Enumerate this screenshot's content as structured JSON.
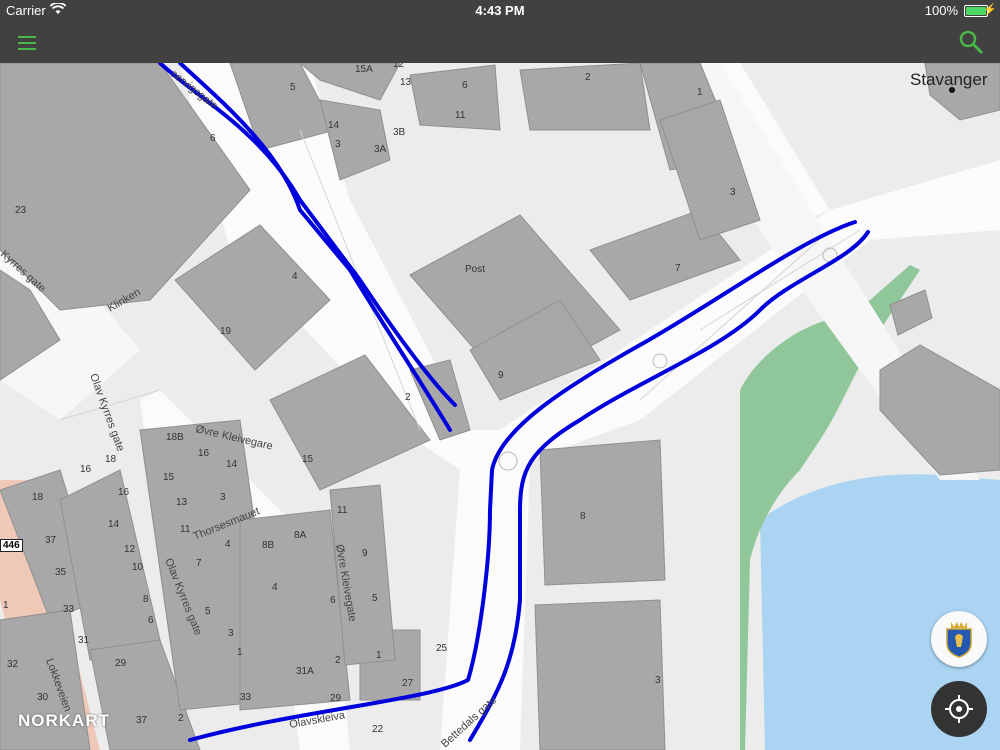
{
  "status_bar": {
    "carrier": "Carrier",
    "time": "4:43 PM",
    "battery": "100%"
  },
  "nav": {
    "menu_icon": "hamburger-menu-icon",
    "search_icon": "search-icon",
    "accent_color": "#49b64a"
  },
  "map": {
    "place_label": "Stavanger",
    "poi_label": "Post",
    "streets": [
      "Klinken",
      "Olav Kyrres gate",
      "Olav Kyrres gate",
      "Olav Kyrres gate",
      "Øvre Kleivegare",
      "Thorsesmauet",
      "Øvre Kleivegate",
      "Lokkeveien",
      "Olavskleiva",
      "Bettedals gate",
      "servigsgate",
      "Kyrres gate"
    ],
    "house_numbers": {
      "h1": "5",
      "h2": "15A",
      "h3": "12",
      "h4": "13",
      "h5": "6",
      "h6": "11",
      "h7": "2",
      "h8": "1",
      "h9": "6",
      "h10": "14",
      "h11": "3B",
      "h12": "3",
      "h13": "3A",
      "h14": "3",
      "h15": "23",
      "h16": "7",
      "h17": "4",
      "h18": "19",
      "h19": "9",
      "h20": "2",
      "h21": "15",
      "h22": "18B",
      "h23": "16",
      "h24": "14",
      "h25": "15",
      "h26": "13",
      "h27": "3",
      "h28": "11",
      "h29": "8A",
      "h30": "8B",
      "h31": "4",
      "h32": "11",
      "h33": "9",
      "h34": "7",
      "h35": "5",
      "h36": "4",
      "h37": "6",
      "h38": "5",
      "h39": "3",
      "h40": "1",
      "h41": "25",
      "h42": "1",
      "h43": "2",
      "h44": "31A",
      "h45": "27",
      "h46": "33",
      "h47": "29",
      "h48": "22",
      "h49": "2",
      "h50": "16",
      "h51": "18",
      "h52": "18",
      "h53": "16",
      "h54": "37",
      "h55": "14",
      "h56": "35",
      "h57": "12",
      "h58": "10",
      "h59": "33",
      "h60": "8",
      "h61": "31",
      "h62": "6",
      "h63": "29",
      "h64": "32",
      "h65": "30",
      "h66": "37",
      "h67": "8",
      "h68": "3",
      "h69": "1"
    },
    "route_number": "446",
    "route_color": "#0000dd",
    "water_color": "#aad4f2",
    "park_color": "#8fc69a"
  },
  "branding": {
    "logo_text": "NORKART"
  },
  "controls": {
    "crest_icon": "city-crest-icon",
    "locate_icon": "locate-crosshair-icon"
  }
}
